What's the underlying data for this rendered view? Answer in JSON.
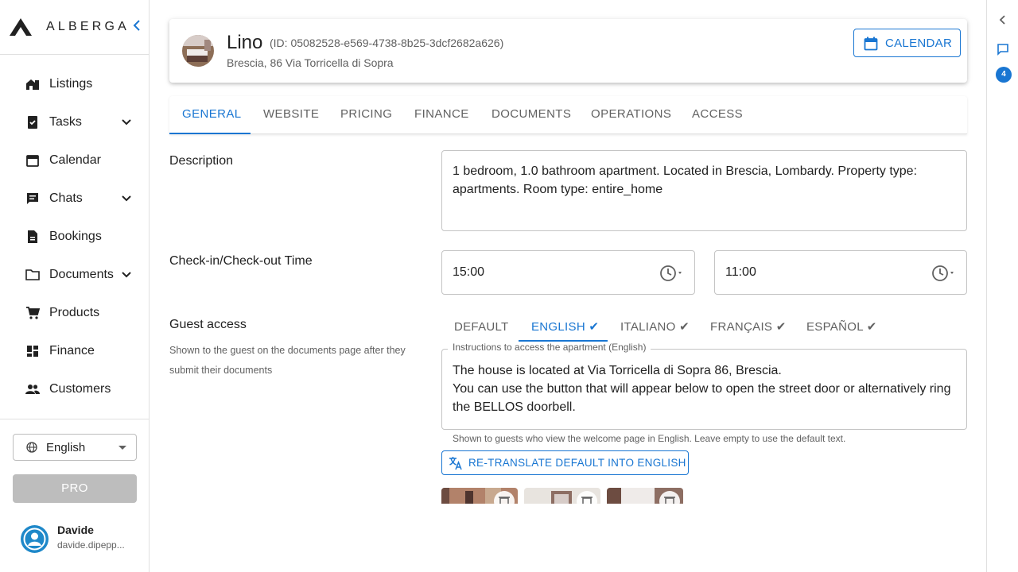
{
  "brand": {
    "name": "ALBERGA"
  },
  "sidebar": {
    "items": [
      {
        "label": "Listings",
        "icon": "listings-icon"
      },
      {
        "label": "Tasks",
        "icon": "tasks-icon",
        "expandable": true
      },
      {
        "label": "Calendar",
        "icon": "calendar-icon"
      },
      {
        "label": "Chats",
        "icon": "chats-icon",
        "expandable": true
      },
      {
        "label": "Bookings",
        "icon": "bookings-icon"
      },
      {
        "label": "Documents",
        "icon": "folder-icon",
        "expandable": true
      },
      {
        "label": "Products",
        "icon": "cart-icon"
      },
      {
        "label": "Finance",
        "icon": "finance-icon"
      },
      {
        "label": "Customers",
        "icon": "customers-icon"
      }
    ],
    "language": "English",
    "pro_label": "PRO",
    "user": {
      "name": "Davide",
      "email": "davide.dipepp..."
    }
  },
  "rail": {
    "badge": "4"
  },
  "header": {
    "name": "Lino",
    "id_text": "(ID: 05082528-e569-4738-8b25-3dcf2682a626)",
    "address": "Brescia, 86 Via Torricella di Sopra",
    "calendar_label": "CALENDAR"
  },
  "tabs": [
    "GENERAL",
    "WEBSITE",
    "PRICING",
    "FINANCE",
    "DOCUMENTS",
    "OPERATIONS",
    "ACCESS"
  ],
  "form": {
    "description_label": "Description",
    "description_value": "1 bedroom, 1.0 bathroom apartment. Located in Brescia, Lombardy. Property type: apartments. Room type: entire_home",
    "checkin_label": "Check-in/Check-out Time",
    "checkin_value": "15:00",
    "checkout_value": "11:00",
    "guest_access_label": "Guest access",
    "guest_access_desc": "Shown to the guest on the documents page after they submit their documents",
    "lang_tabs": [
      "DEFAULT",
      "ENGLISH ✔",
      "ITALIANO ✔",
      "FRANÇAIS ✔",
      "ESPAÑOL ✔"
    ],
    "instructions_label": "Instructions to access the apartment (English)",
    "instructions_line1": "The house is located at Via Torricella di Sopra 86, Brescia.",
    "instructions_line2": "You can use the button that will appear below to open the street door or alternatively ring the BELLOS doorbell.",
    "instructions_help": "Shown to guests who view the welcome page in English. Leave empty to use the default text.",
    "retranslate_label": "RE-TRANSLATE DEFAULT INTO ENGLISH"
  },
  "colors": {
    "primary": "#1976d2",
    "border": "#c4c4c4",
    "muted": "#616161"
  }
}
